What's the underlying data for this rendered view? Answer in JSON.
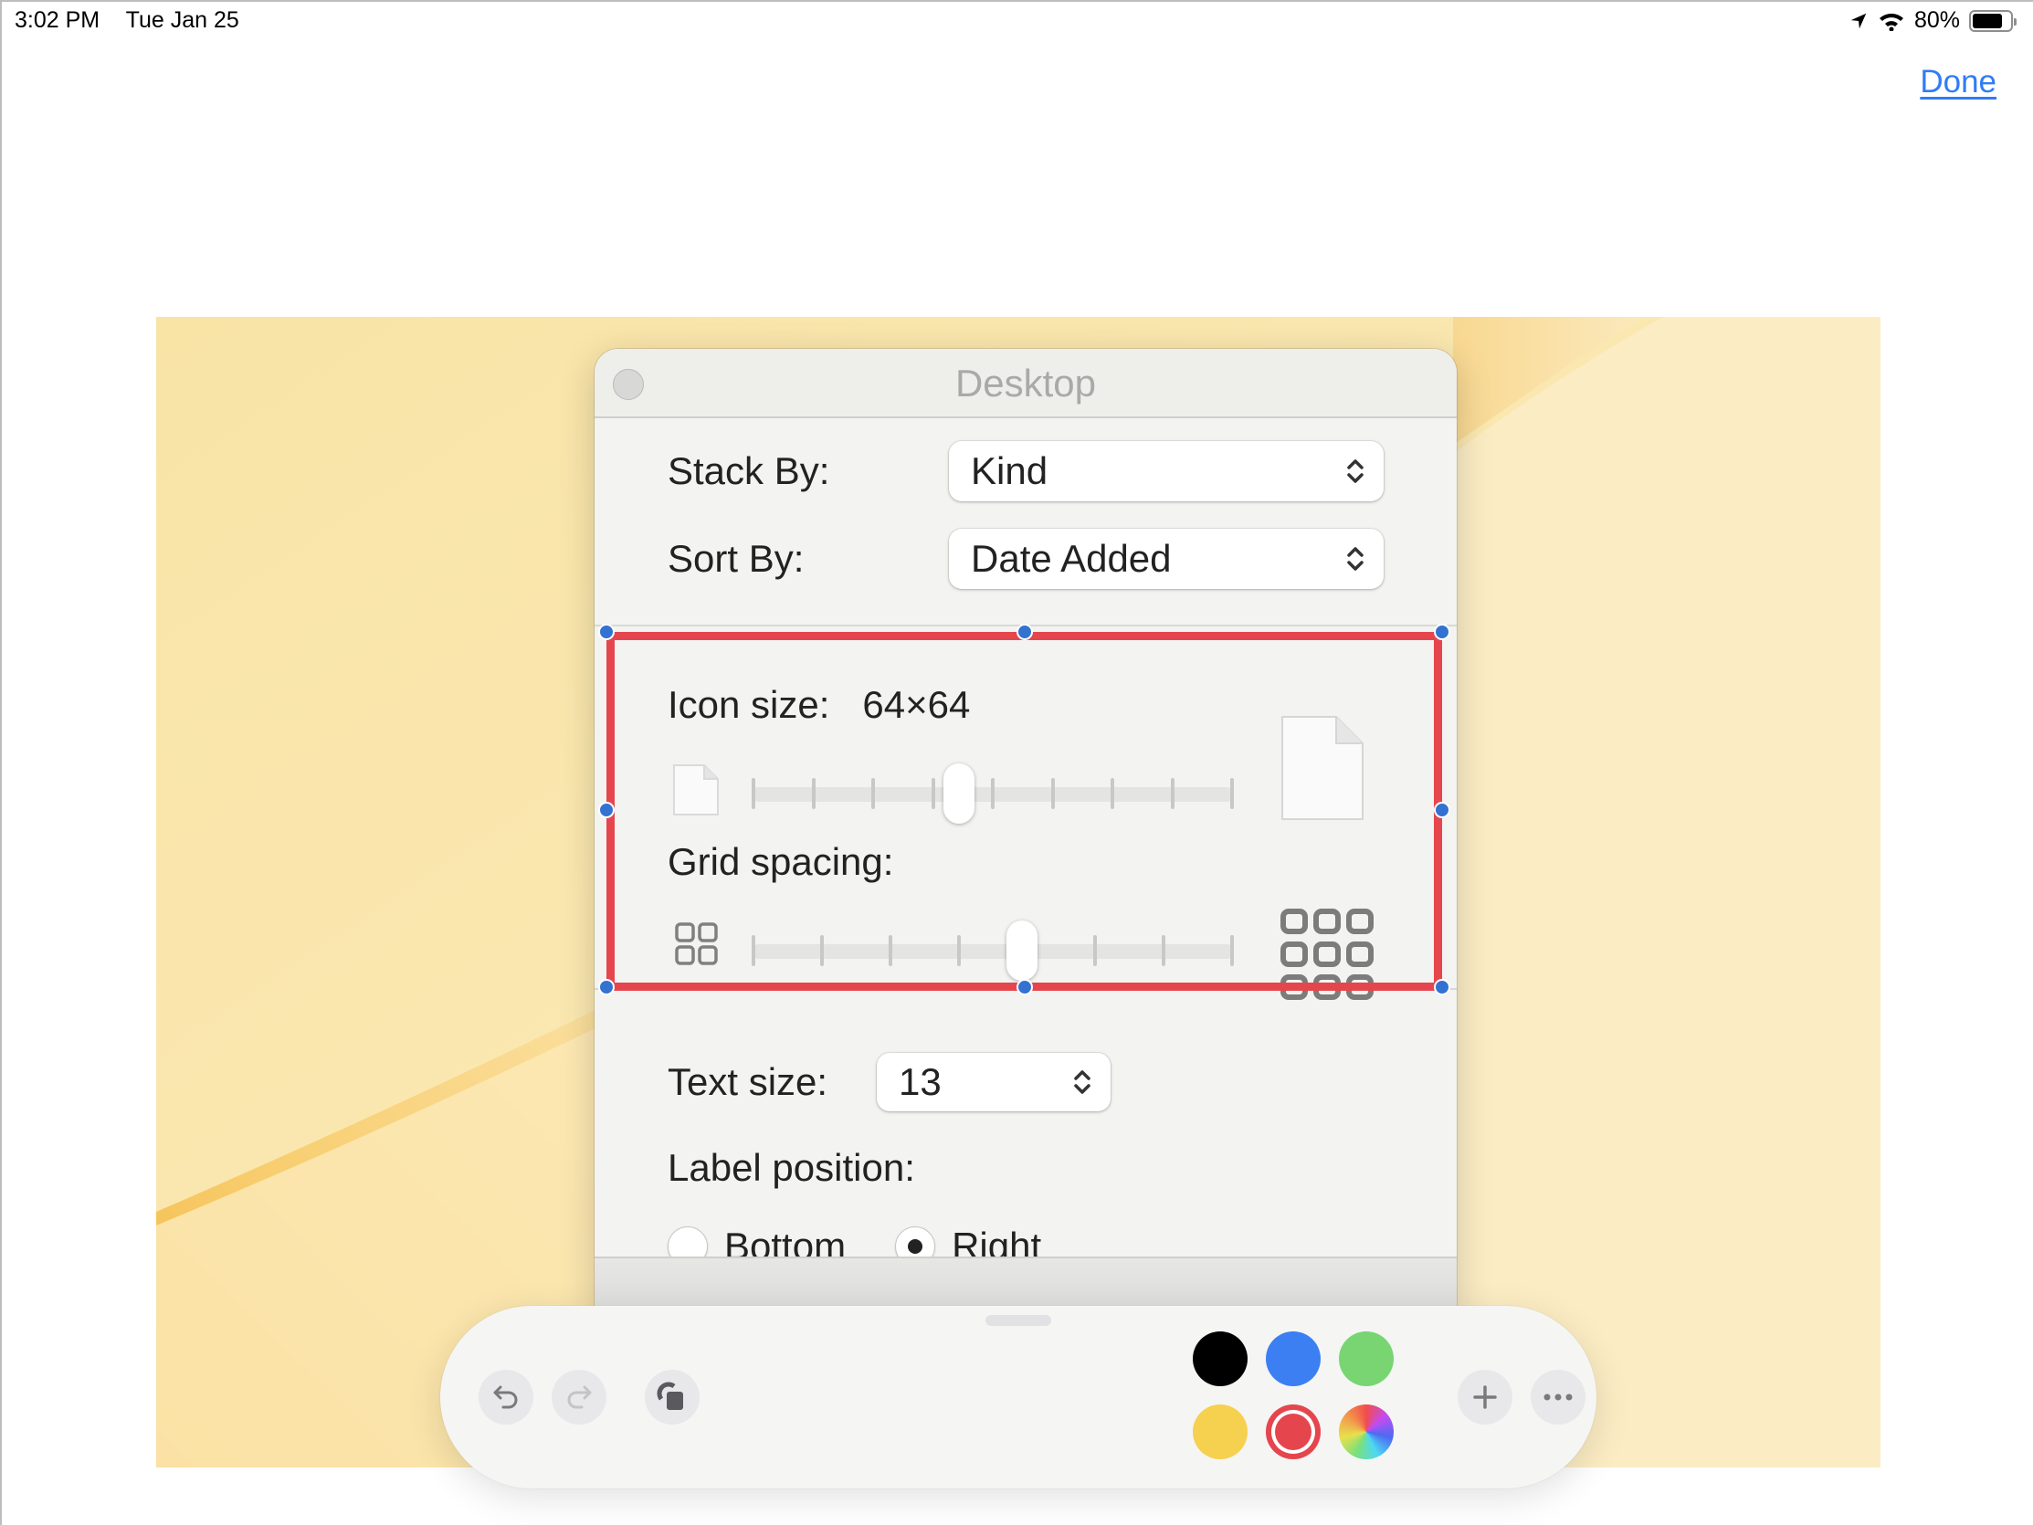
{
  "status_bar": {
    "time": "3:02 PM",
    "date": "Tue Jan 25",
    "battery_percent": "80%",
    "battery_level": 0.8,
    "icons": [
      "location-arrow-icon",
      "wifi-icon",
      "battery-icon"
    ]
  },
  "header": {
    "done_label": "Done"
  },
  "window": {
    "title": "Desktop",
    "stack_by": {
      "label": "Stack By:",
      "value": "Kind"
    },
    "sort_by": {
      "label": "Sort By:",
      "value": "Date Added"
    },
    "icon_size": {
      "label": "Icon size:",
      "value": "64×64",
      "slider_ticks": 9,
      "slider_fraction": 0.43
    },
    "grid_spacing": {
      "label": "Grid spacing:",
      "slider_ticks": 8,
      "slider_fraction": 0.56
    },
    "text_size": {
      "label": "Text size:",
      "value": "13"
    },
    "label_position": {
      "label": "Label position:",
      "options": [
        {
          "label": "Bottom",
          "selected": false
        },
        {
          "label": "Right",
          "selected": true
        }
      ]
    }
  },
  "markup": {
    "selection_color": "#e5464d",
    "handle_color": "#3372d0"
  },
  "toolbar": {
    "buttons": [
      "undo",
      "redo",
      "shape-layers"
    ],
    "colors": [
      {
        "name": "black",
        "hex": "#000000",
        "selected": false
      },
      {
        "name": "blue",
        "hex": "#3b7ff2",
        "selected": false
      },
      {
        "name": "green",
        "hex": "#78d572",
        "selected": false
      },
      {
        "name": "yellow",
        "hex": "#f6d04f",
        "selected": false
      },
      {
        "name": "red",
        "hex": "#e5464d",
        "selected": true
      },
      {
        "name": "color-picker",
        "hex": "multicolor",
        "selected": false
      }
    ],
    "extra_buttons": [
      "add",
      "more"
    ]
  }
}
